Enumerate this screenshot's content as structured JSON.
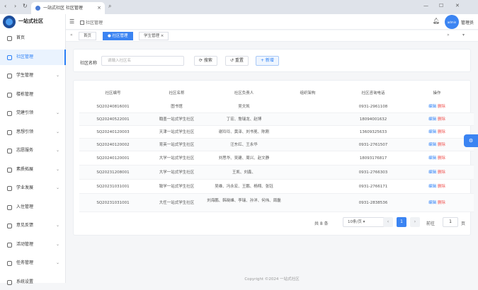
{
  "browser": {
    "tab_title": "一站式社区 社区管理"
  },
  "sidebar": {
    "brand": "一站式社区",
    "items": [
      {
        "label": "首页",
        "chevron": false,
        "active": false
      },
      {
        "label": "社区管理",
        "chevron": false,
        "active": true
      },
      {
        "label": "学生管理",
        "chevron": true,
        "active": false
      },
      {
        "label": "楼栋管理",
        "chevron": false,
        "active": false
      },
      {
        "label": "党建引领",
        "chevron": true,
        "active": false
      },
      {
        "label": "思想引领",
        "chevron": true,
        "active": false
      },
      {
        "label": "志愿服务",
        "chevron": true,
        "active": false
      },
      {
        "label": "素质拓展",
        "chevron": true,
        "active": false
      },
      {
        "label": "学业发展",
        "chevron": true,
        "active": false
      },
      {
        "label": "入住管理",
        "chevron": false,
        "active": false
      },
      {
        "label": "意见反馈",
        "chevron": true,
        "active": false
      },
      {
        "label": "活动管理",
        "chevron": true,
        "active": false
      },
      {
        "label": "任务管理",
        "chevron": true,
        "active": false
      },
      {
        "label": "系统设置",
        "chevron": false,
        "active": false
      }
    ]
  },
  "header": {
    "breadcrumb": "社区管理",
    "avatar_text": "admin",
    "username": "管理员"
  },
  "tags": [
    {
      "label": "首页",
      "active": false
    },
    {
      "label": "● 社区管理",
      "active": true
    },
    {
      "label": "学生管理 ×",
      "active": false
    }
  ],
  "search": {
    "label": "社区名称",
    "placeholder": "请输入社区名",
    "search_btn": "⟳ 搜索",
    "reset_btn": "↺ 重置",
    "add_btn": "+ 新增"
  },
  "table": {
    "columns": [
      "社区编号",
      "社区名称",
      "社区负责人",
      "组织架构",
      "社区咨询电话",
      "操作"
    ],
    "edit_label": "编辑",
    "delete_label": "删除",
    "rows": [
      {
        "code": "SQ20240816001",
        "name": "图书馆",
        "leader": "吴文凯",
        "org": "",
        "phone": "0931-2961108"
      },
      {
        "code": "SQ20240522001",
        "name": "翰墨一站式学生社区",
        "leader": "丁宏、詹瑞龙、赵博",
        "org": "",
        "phone": "18094001632"
      },
      {
        "code": "SQ20240120003",
        "name": "天津一站式学生社区",
        "leader": "谢玲玲、黄泽、刘书冕、陈刚",
        "org": "",
        "phone": "13609325633"
      },
      {
        "code": "SQ20240120002",
        "name": "育英一站式学生社区",
        "leader": "汪东红、王永华",
        "org": "",
        "phone": "0931-2761507"
      },
      {
        "code": "SQ20240120001",
        "name": "大学一站式学生社区",
        "leader": "刘思华、吴建、周兴、赵文静",
        "org": "",
        "phone": "18093176817"
      },
      {
        "code": "SQ20231208001",
        "name": "大学一站式学生社区",
        "leader": "王凯、刘鑫、",
        "org": "",
        "phone": "0931-2766303"
      },
      {
        "code": "SQ20231031001",
        "name": "致学一站式学生社区",
        "leader": "吴维、冯永宏、王鹏、杨翔、张钰",
        "org": "",
        "phone": "0931-2766171"
      },
      {
        "code": "SQ20231031001",
        "name": "大任一站式学生社区",
        "leader": "刘海鹏、韩晓峰、李瑞、孙洋、何伟、周磊",
        "org": "",
        "phone": "0931-2838536"
      }
    ]
  },
  "pagination": {
    "total": "共 8 条",
    "page_size": "10条/页",
    "prev": "‹",
    "current": "1",
    "next": "›",
    "goto": "前往",
    "page_input": "1",
    "page_unit": "页"
  },
  "footer": "Copyright ©2024 一站式社区"
}
